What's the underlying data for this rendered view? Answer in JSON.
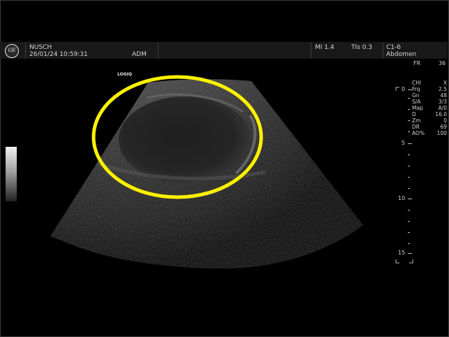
{
  "header": {
    "logo_text": "GE",
    "patient_name": "NUSCH",
    "datetime": "26/01/24 10:59:31",
    "operator": "ADM",
    "mi": "MI 1.4",
    "tis": "TIs 0.3",
    "probe": "C1-6",
    "preset": "Abdomen"
  },
  "frame_rate": {
    "label": "FR",
    "value": "36"
  },
  "brand_label": "LOGIQ",
  "params": [
    {
      "label": "CHI",
      "value": "X"
    },
    {
      "label": "Frq",
      "value": "2.5"
    },
    {
      "label": "Gn",
      "value": "48"
    },
    {
      "label": "S/A",
      "value": "3/3"
    },
    {
      "label": "Map",
      "value": "A/0"
    },
    {
      "label": "D",
      "value": "16.0"
    },
    {
      "label": "Zm",
      "value": "0"
    },
    {
      "label": "DR",
      "value": "69"
    },
    {
      "label": "AO%",
      "value": "100"
    }
  ],
  "depth_scale": {
    "labels": [
      "0",
      "5",
      "10",
      "15"
    ]
  },
  "annotation": {
    "color": "#FFF200"
  },
  "colors": {
    "background": "#000000",
    "header": "#191919",
    "annotation": "#FFF200"
  }
}
